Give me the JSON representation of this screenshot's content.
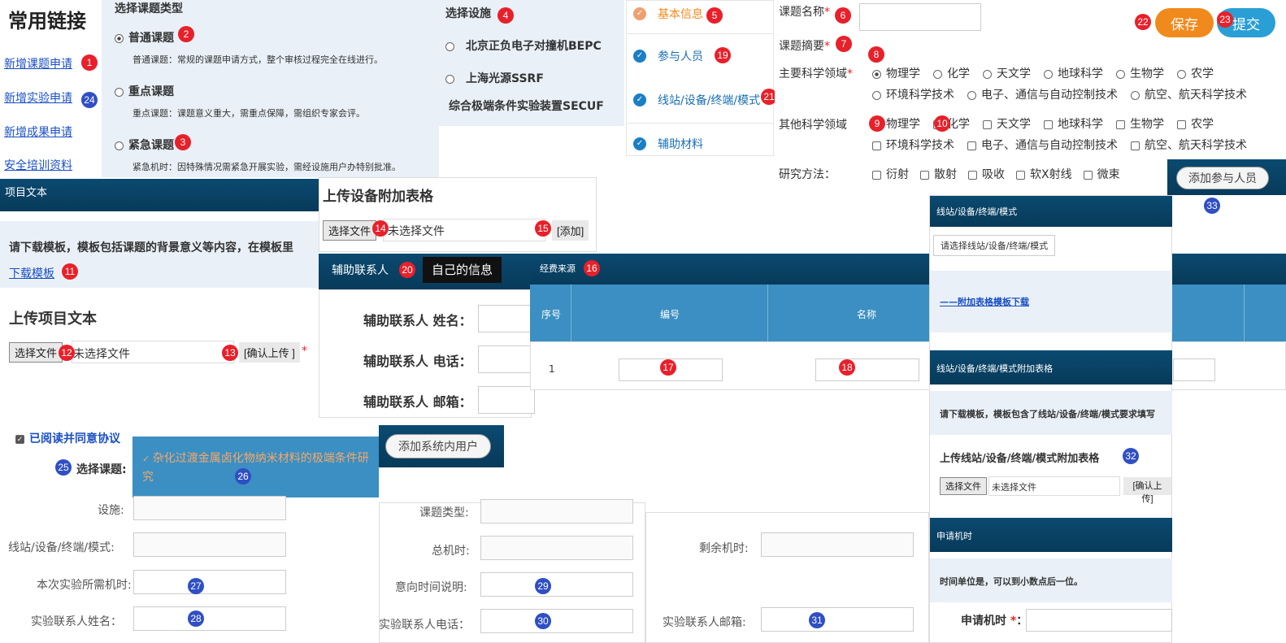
{
  "links": {
    "title": "常用链接",
    "items": [
      "新增课题申请",
      "新增实验申请",
      "新增成果申请",
      "安全培训资料"
    ]
  },
  "topic_type": {
    "header": "选择课题类型",
    "options": [
      {
        "label": "普通课题",
        "desc": "普通课题：常规的课题申请方式，整个审核过程完全在线进行。"
      },
      {
        "label": "重点课题",
        "desc": "重点课题：课题意义重大，需重点保障，需组织专家会评。"
      },
      {
        "label": "紧急课题",
        "desc": "紧急机时：因特殊情况需紧急开展实验，需经设施用户办特别批准。"
      }
    ]
  },
  "facility": {
    "header": "选择设施",
    "options": [
      "北京正负电子对撞机BEPC",
      "上海光源SSRF",
      "综合极端条件实验装置SECUF"
    ]
  },
  "steps": [
    "基本信息",
    "参与人员",
    "线站/设备/终端/模式",
    "辅助材料"
  ],
  "form": {
    "name_label": "课题名称",
    "abstract_label": "课题摘要",
    "main_field_label": "主要科学领域",
    "other_field_label": "其他科学领域",
    "method_label": "研究方法：",
    "fields_row1": [
      "物理学",
      "化学",
      "天文学",
      "地球科学",
      "生物学",
      "农学"
    ],
    "fields_row2": [
      "环境科学技术",
      "电子、通信与自动控制技术",
      "航空、航天科学技术"
    ],
    "methods": [
      "衍射",
      "散射",
      "吸收",
      "软X射线",
      "微束"
    ]
  },
  "actions": {
    "save": "保存",
    "submit": "提交",
    "add_person": "添加参与人员"
  },
  "project_text": {
    "bar": "项目文本",
    "notice": "请下载模板，模板包括课题的背景意义等内容，在模板里",
    "download": "下载模板",
    "upload_title": "上传项目文本",
    "choose": "选择文件",
    "nofile": "未选择文件",
    "confirm": "[确认上传 ]"
  },
  "equip_table": {
    "title": "上传设备附加表格",
    "choose": "选择文件",
    "nofile": "未选择文件",
    "add": "[添加]"
  },
  "assist": {
    "bar": "辅助联系人",
    "tooltip": "自己的信息",
    "name": "辅助联系人 姓名：",
    "phone": "辅助联系人 电话：",
    "email": "辅助联系人 邮箱："
  },
  "funding": {
    "bar": "经费来源",
    "cols": [
      "序号",
      "编号",
      "名称"
    ],
    "row_index": "1"
  },
  "station": {
    "bar": "线站/设备/终端/模式",
    "select": "请选择线站/设备/终端/模式",
    "download": "——附加表格模板下载",
    "bar2": "线站/设备/终端/模式附加表格",
    "notice": "请下载模板，模板包含了线站/设备/终端/模式要求填写",
    "upload_title": "上传线站/设备/终端/模式附加表格",
    "choose": "选择文件",
    "nofile": "未选择文件",
    "confirm": "[确认上传]",
    "bar3": "申请机时",
    "hint": "时间单位是，可以到小数点后一位。",
    "hours": "申请机时"
  },
  "agreement": {
    "label": "已阅读并同意协议",
    "select_label": "选择课题:",
    "dropdown": "杂化过渡金属卤化物纳米材料的极端条件研究"
  },
  "add_user": "添加系统内用户",
  "exp": {
    "facility": "设施:",
    "station": "线站/设备/终端/模式:",
    "hours": "本次实验所需机时:",
    "contact": "实验联系人姓名：",
    "type": "课题类型:",
    "total": "总机时:",
    "intent": "意向时间说明:",
    "phone": "实验联系人电话：",
    "remain": "剩余机时:",
    "email": "实验联系人邮箱:"
  },
  "badges": [
    "1",
    "2",
    "3",
    "4",
    "5",
    "6",
    "7",
    "8",
    "9",
    "10",
    "11",
    "12",
    "13",
    "14",
    "15",
    "16",
    "17",
    "18",
    "19",
    "20",
    "21",
    "22",
    "23",
    "24",
    "25",
    "26",
    "27",
    "28",
    "29",
    "30",
    "31",
    "32",
    "33"
  ],
  "colors": {
    "bar": "#0a4a70",
    "accent": "#f08a1c",
    "submit": "#2a9fd6",
    "red_badge": "#e8202a",
    "blue_badge": "#2f4fc4"
  }
}
